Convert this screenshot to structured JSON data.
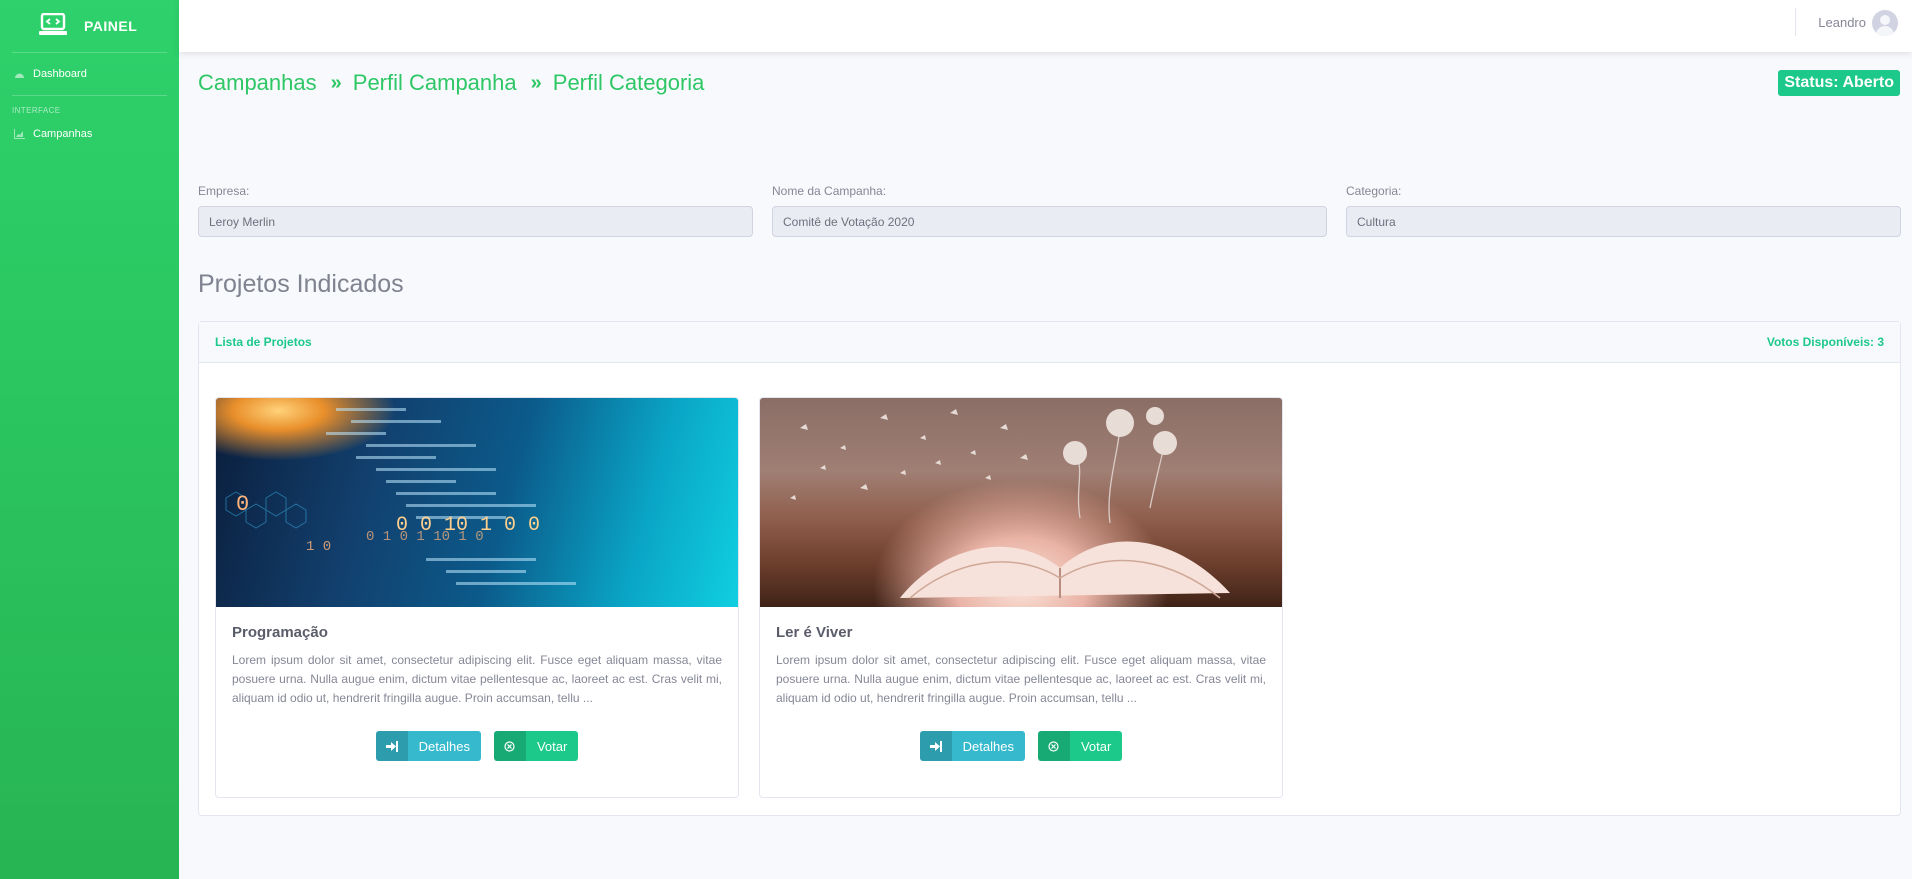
{
  "sidebar": {
    "brand": "PAINEL",
    "dashboard_label": "Dashboard",
    "heading": "INTERFACE",
    "campanhas_label": "Campanhas"
  },
  "topbar": {
    "user_name": "Leandro"
  },
  "breadcrumb": {
    "items": [
      "Campanhas",
      "Perfil Campanha",
      "Perfil Categoria"
    ],
    "separator": "»"
  },
  "status": "Status: Aberto",
  "fields": {
    "empresa": {
      "label": "Empresa:",
      "value": "Leroy Merlin"
    },
    "campanha": {
      "label": "Nome da Campanha:",
      "value": "Comitê de Votação 2020"
    },
    "categoria": {
      "label": "Categoria:",
      "value": "Cultura"
    }
  },
  "section_title": "Projetos Indicados",
  "list": {
    "title": "Lista de Projetos",
    "votes": "Votos Disponíveis: 3"
  },
  "projects": [
    {
      "title": "Programação",
      "description": "Lorem ipsum dolor sit amet, consectetur adipiscing elit. Fusce eget aliquam massa, vitae posuere urna. Nulla augue enim, dictum vitae pellentesque ac, laoreet ac est. Cras velit mi, aliquam id odio ut, hendrerit fringilla augue. Proin accumsan, tellu ...",
      "details_label": "Detalhes",
      "vote_label": "Votar",
      "image_text": "0 0 10 1 0 0"
    },
    {
      "title": "Ler é Viver",
      "description": "Lorem ipsum dolor sit amet, consectetur adipiscing elit. Fusce eget aliquam massa, vitae posuere urna. Nulla augue enim, dictum vitae pellentesque ac, laoreet ac est. Cras velit mi, aliquam id odio ut, hendrerit fringilla augue. Proin accumsan, tellu ...",
      "details_label": "Detalhes",
      "vote_label": "Votar"
    }
  ],
  "colors": {
    "primary": "#1cc88a",
    "info": "#36b9cc",
    "sidebar": "#2bc760"
  },
  "icons": {
    "brand": "laptop-code-icon",
    "dashboard": "tachometer-icon",
    "campanhas": "chart-area-icon",
    "details": "sign-in-icon",
    "vote": "times-circle-icon",
    "avatar": "user-circle-icon"
  }
}
